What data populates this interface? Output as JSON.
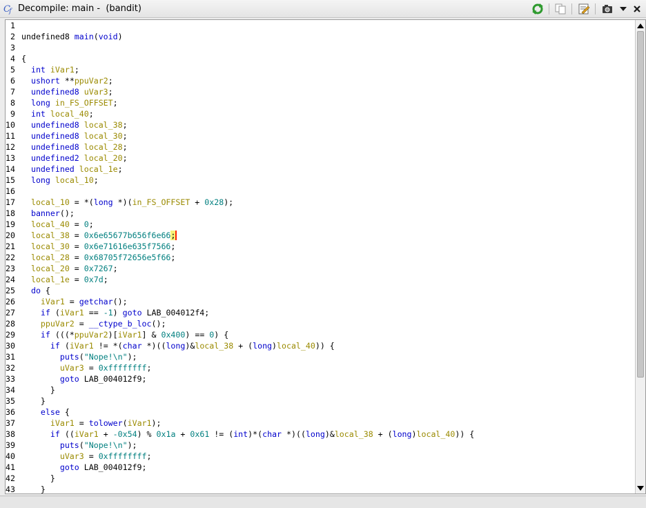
{
  "window": {
    "title": "Decompile: main -  (bandit)"
  },
  "toolbar": {
    "buttons": [
      {
        "icon": "refresh-icon"
      },
      {
        "icon": "copy-icon"
      },
      {
        "icon": "edit-function-signature-icon"
      },
      {
        "icon": "snapshot-icon"
      },
      {
        "icon": "menu-dropdown-icon"
      }
    ]
  },
  "code": {
    "selected_line": 20,
    "lines": [
      {
        "n": "1",
        "t": []
      },
      {
        "n": "2",
        "t": [
          [
            "undefined8",
            "t"
          ],
          [
            " ",
            "p"
          ],
          [
            "main",
            "f"
          ],
          [
            "(",
            "p"
          ],
          [
            "void",
            "k"
          ],
          [
            ")",
            "p"
          ]
        ]
      },
      {
        "n": "3",
        "t": []
      },
      {
        "n": "4",
        "t": [
          [
            "{",
            "p"
          ]
        ]
      },
      {
        "n": "5",
        "t": [
          [
            "  ",
            "p"
          ],
          [
            "int",
            "k"
          ],
          [
            " ",
            "p"
          ],
          [
            "iVar1",
            "v"
          ],
          [
            ";",
            "p"
          ]
        ]
      },
      {
        "n": "6",
        "t": [
          [
            "  ",
            "p"
          ],
          [
            "ushort",
            "k"
          ],
          [
            " **",
            "p"
          ],
          [
            "ppuVar2",
            "v"
          ],
          [
            ";",
            "p"
          ]
        ]
      },
      {
        "n": "7",
        "t": [
          [
            "  ",
            "p"
          ],
          [
            "undefined8",
            "k"
          ],
          [
            " ",
            "p"
          ],
          [
            "uVar3",
            "v"
          ],
          [
            ";",
            "p"
          ]
        ]
      },
      {
        "n": "8",
        "t": [
          [
            "  ",
            "p"
          ],
          [
            "long",
            "k"
          ],
          [
            " ",
            "p"
          ],
          [
            "in_FS_OFFSET",
            "v"
          ],
          [
            ";",
            "p"
          ]
        ]
      },
      {
        "n": "9",
        "t": [
          [
            "  ",
            "p"
          ],
          [
            "int",
            "k"
          ],
          [
            " ",
            "p"
          ],
          [
            "local_40",
            "v"
          ],
          [
            ";",
            "p"
          ]
        ]
      },
      {
        "n": "10",
        "t": [
          [
            "  ",
            "p"
          ],
          [
            "undefined8",
            "k"
          ],
          [
            " ",
            "p"
          ],
          [
            "local_38",
            "v"
          ],
          [
            ";",
            "p"
          ]
        ]
      },
      {
        "n": "11",
        "t": [
          [
            "  ",
            "p"
          ],
          [
            "undefined8",
            "k"
          ],
          [
            " ",
            "p"
          ],
          [
            "local_30",
            "v"
          ],
          [
            ";",
            "p"
          ]
        ]
      },
      {
        "n": "12",
        "t": [
          [
            "  ",
            "p"
          ],
          [
            "undefined8",
            "k"
          ],
          [
            " ",
            "p"
          ],
          [
            "local_28",
            "v"
          ],
          [
            ";",
            "p"
          ]
        ]
      },
      {
        "n": "13",
        "t": [
          [
            "  ",
            "p"
          ],
          [
            "undefined2",
            "k"
          ],
          [
            " ",
            "p"
          ],
          [
            "local_20",
            "v"
          ],
          [
            ";",
            "p"
          ]
        ]
      },
      {
        "n": "14",
        "t": [
          [
            "  ",
            "p"
          ],
          [
            "undefined",
            "k"
          ],
          [
            " ",
            "p"
          ],
          [
            "local_1e",
            "v"
          ],
          [
            ";",
            "p"
          ]
        ]
      },
      {
        "n": "15",
        "t": [
          [
            "  ",
            "p"
          ],
          [
            "long",
            "k"
          ],
          [
            " ",
            "p"
          ],
          [
            "local_10",
            "v"
          ],
          [
            ";",
            "p"
          ]
        ]
      },
      {
        "n": "16",
        "t": []
      },
      {
        "n": "17",
        "t": [
          [
            "  ",
            "p"
          ],
          [
            "local_10",
            "v"
          ],
          [
            " = *(",
            "p"
          ],
          [
            "long",
            "k"
          ],
          [
            " *)(",
            "p"
          ],
          [
            "in_FS_OFFSET",
            "v"
          ],
          [
            " + ",
            "p"
          ],
          [
            "0x28",
            "c"
          ],
          [
            ");",
            "p"
          ]
        ]
      },
      {
        "n": "18",
        "t": [
          [
            "  ",
            "p"
          ],
          [
            "banner",
            "f"
          ],
          [
            "();",
            "p"
          ]
        ]
      },
      {
        "n": "19",
        "t": [
          [
            "  ",
            "p"
          ],
          [
            "local_40",
            "v"
          ],
          [
            " = ",
            "p"
          ],
          [
            "0",
            "c"
          ],
          [
            ";",
            "p"
          ]
        ]
      },
      {
        "n": "20",
        "t": [
          [
            "  ",
            "p"
          ],
          [
            "local_38",
            "v"
          ],
          [
            " = ",
            "p"
          ],
          [
            "0x6e65677b656f6e66",
            "c"
          ],
          [
            ";",
            "h"
          ]
        ]
      },
      {
        "n": "21",
        "t": [
          [
            "  ",
            "p"
          ],
          [
            "local_30",
            "v"
          ],
          [
            " = ",
            "p"
          ],
          [
            "0x6e71616e635f7566",
            "c"
          ],
          [
            ";",
            "p"
          ]
        ]
      },
      {
        "n": "22",
        "t": [
          [
            "  ",
            "p"
          ],
          [
            "local_28",
            "v"
          ],
          [
            " = ",
            "p"
          ],
          [
            "0x68705f72656e5f66",
            "c"
          ],
          [
            ";",
            "p"
          ]
        ]
      },
      {
        "n": "23",
        "t": [
          [
            "  ",
            "p"
          ],
          [
            "local_20",
            "v"
          ],
          [
            " = ",
            "p"
          ],
          [
            "0x7267",
            "c"
          ],
          [
            ";",
            "p"
          ]
        ]
      },
      {
        "n": "24",
        "t": [
          [
            "  ",
            "p"
          ],
          [
            "local_1e",
            "v"
          ],
          [
            " = ",
            "p"
          ],
          [
            "0x7d",
            "c"
          ],
          [
            ";",
            "p"
          ]
        ]
      },
      {
        "n": "25",
        "t": [
          [
            "  ",
            "p"
          ],
          [
            "do",
            "k"
          ],
          [
            " {",
            "p"
          ]
        ]
      },
      {
        "n": "26",
        "t": [
          [
            "    ",
            "p"
          ],
          [
            "iVar1",
            "v"
          ],
          [
            " = ",
            "p"
          ],
          [
            "getchar",
            "f"
          ],
          [
            "();",
            "p"
          ]
        ]
      },
      {
        "n": "27",
        "t": [
          [
            "    ",
            "p"
          ],
          [
            "if",
            "k"
          ],
          [
            " (",
            "p"
          ],
          [
            "iVar1",
            "v"
          ],
          [
            " == ",
            "p"
          ],
          [
            "-1",
            "c"
          ],
          [
            ") ",
            "p"
          ],
          [
            "goto",
            "k"
          ],
          [
            " LAB_004012f4;",
            "p"
          ]
        ]
      },
      {
        "n": "28",
        "t": [
          [
            "    ",
            "p"
          ],
          [
            "ppuVar2",
            "v"
          ],
          [
            " = ",
            "p"
          ],
          [
            "__ctype_b_loc",
            "f"
          ],
          [
            "();",
            "p"
          ]
        ]
      },
      {
        "n": "29",
        "t": [
          [
            "    ",
            "p"
          ],
          [
            "if",
            "k"
          ],
          [
            " (((*",
            "p"
          ],
          [
            "ppuVar2",
            "v"
          ],
          [
            ")[",
            "p"
          ],
          [
            "iVar1",
            "v"
          ],
          [
            "] & ",
            "p"
          ],
          [
            "0x400",
            "c"
          ],
          [
            ") == ",
            "p"
          ],
          [
            "0",
            "c"
          ],
          [
            ") {",
            "p"
          ]
        ]
      },
      {
        "n": "30",
        "t": [
          [
            "      ",
            "p"
          ],
          [
            "if",
            "k"
          ],
          [
            " (",
            "p"
          ],
          [
            "iVar1",
            "v"
          ],
          [
            " != *(",
            "p"
          ],
          [
            "char",
            "k"
          ],
          [
            " *)((",
            "p"
          ],
          [
            "long",
            "k"
          ],
          [
            ")&",
            "p"
          ],
          [
            "local_38",
            "v"
          ],
          [
            " + (",
            "p"
          ],
          [
            "long",
            "k"
          ],
          [
            ")",
            "p"
          ],
          [
            "local_40",
            "v"
          ],
          [
            ")) {",
            "p"
          ]
        ]
      },
      {
        "n": "31",
        "t": [
          [
            "        ",
            "p"
          ],
          [
            "puts",
            "f"
          ],
          [
            "(",
            "p"
          ],
          [
            "\"Nope!\\n\"",
            "c"
          ],
          [
            ");",
            "p"
          ]
        ]
      },
      {
        "n": "32",
        "t": [
          [
            "        ",
            "p"
          ],
          [
            "uVar3",
            "v"
          ],
          [
            " = ",
            "p"
          ],
          [
            "0xffffffff",
            "c"
          ],
          [
            ";",
            "p"
          ]
        ]
      },
      {
        "n": "33",
        "t": [
          [
            "        ",
            "p"
          ],
          [
            "goto",
            "k"
          ],
          [
            " LAB_004012f9;",
            "p"
          ]
        ]
      },
      {
        "n": "34",
        "t": [
          [
            "      }",
            "p"
          ]
        ]
      },
      {
        "n": "35",
        "t": [
          [
            "    }",
            "p"
          ]
        ]
      },
      {
        "n": "36",
        "t": [
          [
            "    ",
            "p"
          ],
          [
            "else",
            "k"
          ],
          [
            " {",
            "p"
          ]
        ]
      },
      {
        "n": "37",
        "t": [
          [
            "      ",
            "p"
          ],
          [
            "iVar1",
            "v"
          ],
          [
            " = ",
            "p"
          ],
          [
            "tolower",
            "f"
          ],
          [
            "(",
            "p"
          ],
          [
            "iVar1",
            "v"
          ],
          [
            ");",
            "p"
          ]
        ]
      },
      {
        "n": "38",
        "t": [
          [
            "      ",
            "p"
          ],
          [
            "if",
            "k"
          ],
          [
            " ((",
            "p"
          ],
          [
            "iVar1",
            "v"
          ],
          [
            " + ",
            "p"
          ],
          [
            "-0x54",
            "c"
          ],
          [
            ") % ",
            "p"
          ],
          [
            "0x1a",
            "c"
          ],
          [
            " + ",
            "p"
          ],
          [
            "0x61",
            "c"
          ],
          [
            " != (",
            "p"
          ],
          [
            "int",
            "k"
          ],
          [
            ")*(",
            "p"
          ],
          [
            "char",
            "k"
          ],
          [
            " *)((",
            "p"
          ],
          [
            "long",
            "k"
          ],
          [
            ")&",
            "p"
          ],
          [
            "local_38",
            "v"
          ],
          [
            " + (",
            "p"
          ],
          [
            "long",
            "k"
          ],
          [
            ")",
            "p"
          ],
          [
            "local_40",
            "v"
          ],
          [
            ")) {",
            "p"
          ]
        ]
      },
      {
        "n": "39",
        "t": [
          [
            "        ",
            "p"
          ],
          [
            "puts",
            "f"
          ],
          [
            "(",
            "p"
          ],
          [
            "\"Nope!\\n\"",
            "c"
          ],
          [
            ");",
            "p"
          ]
        ]
      },
      {
        "n": "40",
        "t": [
          [
            "        ",
            "p"
          ],
          [
            "uVar3",
            "v"
          ],
          [
            " = ",
            "p"
          ],
          [
            "0xffffffff",
            "c"
          ],
          [
            ";",
            "p"
          ]
        ]
      },
      {
        "n": "41",
        "t": [
          [
            "        ",
            "p"
          ],
          [
            "goto",
            "k"
          ],
          [
            " LAB_004012f9;",
            "p"
          ]
        ]
      },
      {
        "n": "42",
        "t": [
          [
            "      }",
            "p"
          ]
        ]
      },
      {
        "n": "43",
        "t": [
          [
            "    }",
            "p"
          ]
        ]
      }
    ]
  }
}
